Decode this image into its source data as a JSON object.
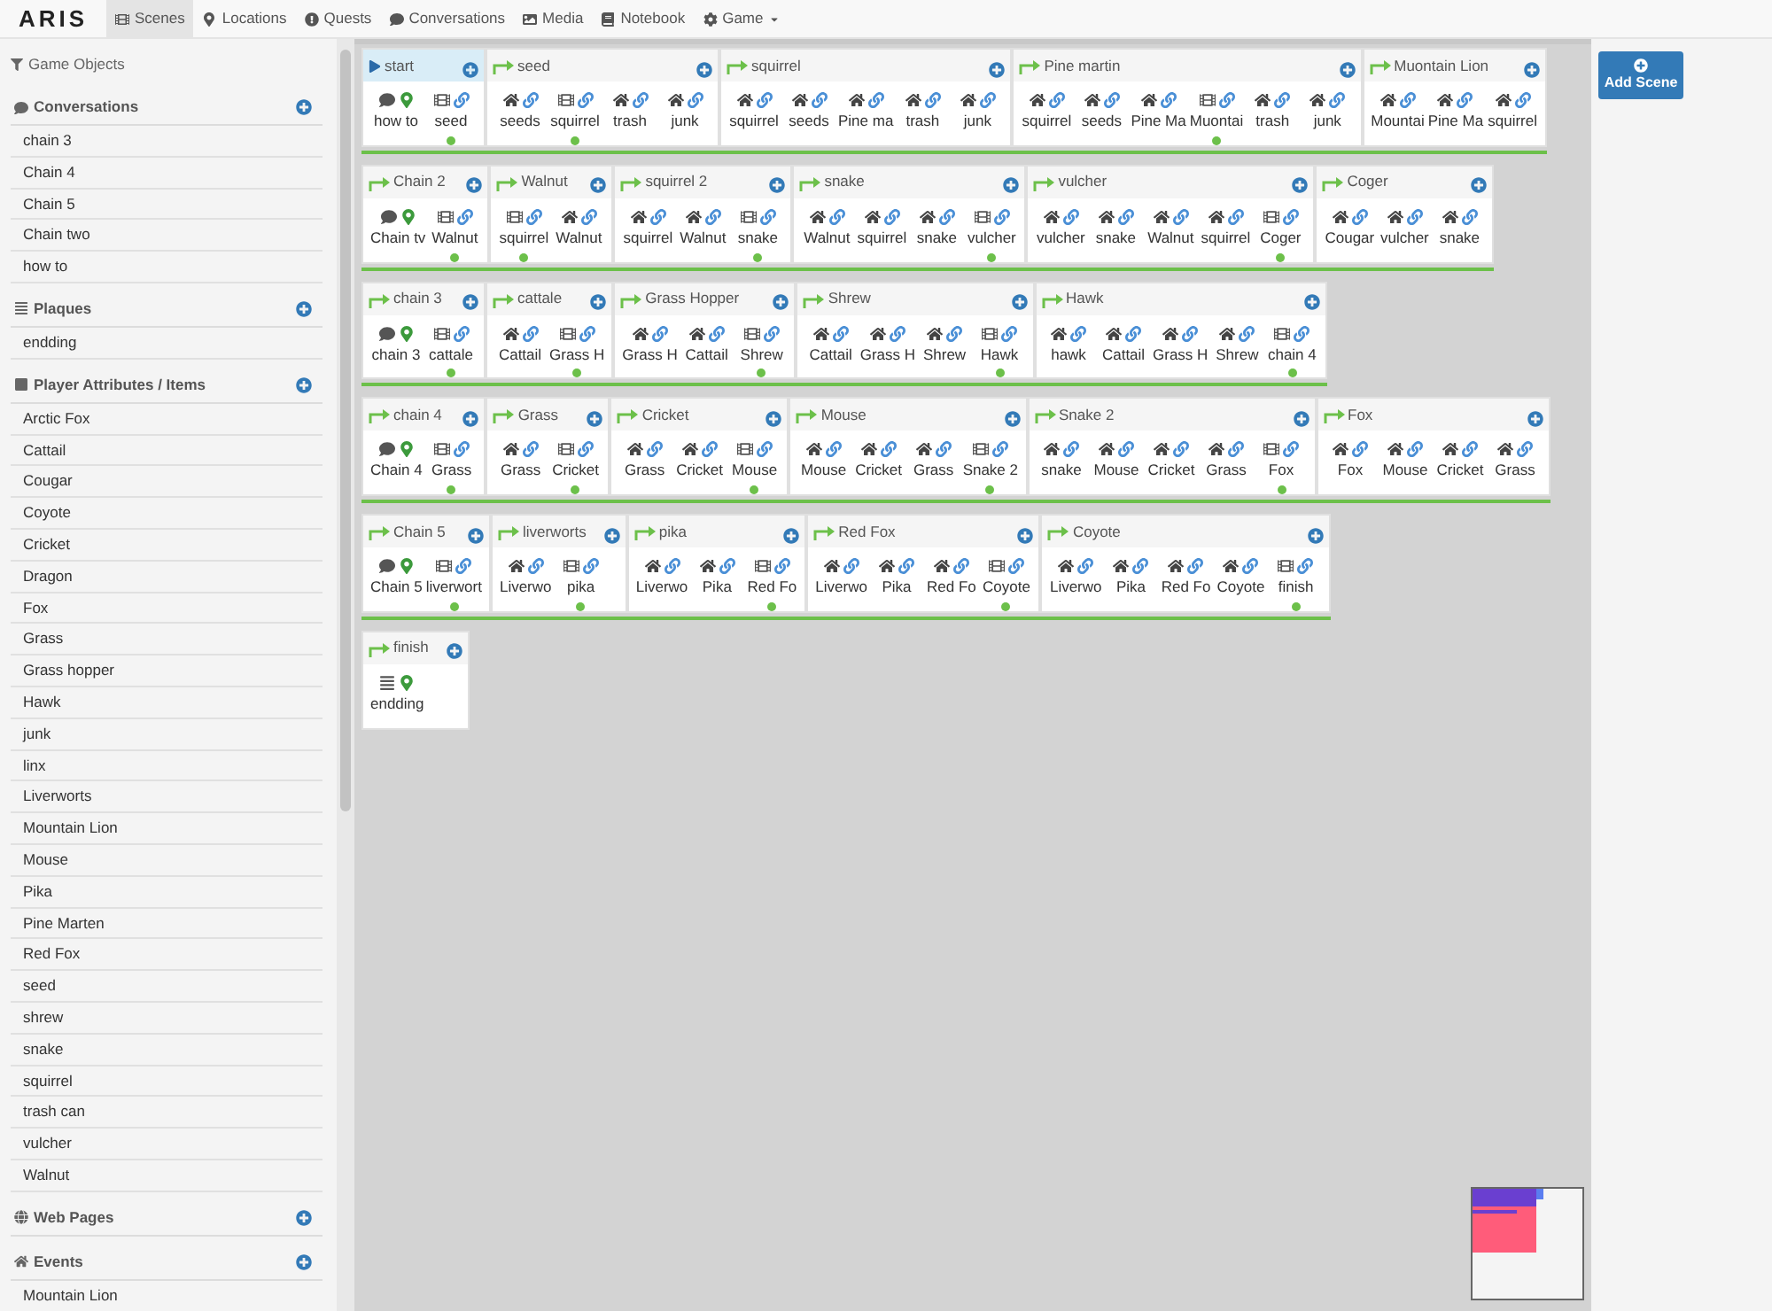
{
  "nav": {
    "logo": "ARIS",
    "tabs": [
      {
        "label": "Scenes",
        "selected": true,
        "dropdown": false
      },
      {
        "label": "Locations",
        "selected": false,
        "dropdown": false
      },
      {
        "label": "Quests",
        "selected": false,
        "dropdown": false
      },
      {
        "label": "Conversations",
        "selected": false,
        "dropdown": false
      },
      {
        "label": "Media",
        "selected": false,
        "dropdown": false
      },
      {
        "label": "Notebook",
        "selected": false,
        "dropdown": false
      },
      {
        "label": "Game",
        "selected": false,
        "dropdown": true
      }
    ]
  },
  "sidebar": {
    "title": "Game Objects",
    "sections": [
      {
        "title": "Conversations",
        "items": [
          "chain 3",
          "Chain 4",
          "Chain 5",
          "Chain two",
          "how to"
        ]
      },
      {
        "title": "Plaques",
        "items": [
          "endding"
        ]
      },
      {
        "title": "Player Attributes / Items",
        "items": [
          "Arctic Fox",
          "Cattail",
          "Cougar",
          "Coyote",
          "Cricket",
          "Dragon",
          "Fox",
          "Grass",
          "Grass hopper",
          "Hawk",
          "junk",
          "linx",
          "Liverworts",
          "Mountain Lion",
          "Mouse",
          "Pika",
          "Pine Marten",
          "Red Fox",
          "seed",
          "shrew",
          "snake",
          "squirrel",
          "trash can",
          "vulcher",
          "Walnut"
        ]
      },
      {
        "title": "Web Pages"
      },
      {
        "title": "Events",
        "items": [
          "Mountain Lion"
        ]
      }
    ]
  },
  "add_scene": {
    "label": "Add Scene"
  },
  "scene_rows": [
    [
      {
        "title": "start",
        "selected": true,
        "start": true,
        "items": [
          {
            "kind": "conversation",
            "label": "how to"
          },
          {
            "kind": "scene",
            "label": "seed"
          }
        ]
      },
      {
        "title": "seed",
        "selected": false,
        "start": false,
        "items": [
          {
            "kind": "item",
            "label": "seeds"
          },
          {
            "kind": "scene",
            "label": "squirrel"
          },
          {
            "kind": "item",
            "label": "trash"
          },
          {
            "kind": "item",
            "label": "junk"
          }
        ]
      },
      {
        "title": "squirrel",
        "selected": false,
        "start": false,
        "items": [
          {
            "kind": "item",
            "label": "squirrel"
          },
          {
            "kind": "item",
            "label": "seeds"
          },
          {
            "kind": "item",
            "label": "Pine ma"
          },
          {
            "kind": "item",
            "label": "trash"
          },
          {
            "kind": "item",
            "label": "junk"
          }
        ]
      },
      {
        "title": "Pine martin",
        "selected": false,
        "start": false,
        "items": [
          {
            "kind": "item",
            "label": "squirrel"
          },
          {
            "kind": "item",
            "label": "seeds"
          },
          {
            "kind": "item",
            "label": "Pine Ma"
          },
          {
            "kind": "scene",
            "label": "Muontai"
          },
          {
            "kind": "item",
            "label": "trash"
          },
          {
            "kind": "item",
            "label": "junk"
          }
        ]
      },
      {
        "title": "Muontain Lion",
        "selected": false,
        "start": false,
        "items": [
          {
            "kind": "item",
            "label": "Mountai"
          },
          {
            "kind": "item",
            "label": "Pine Ma"
          },
          {
            "kind": "item",
            "label": "squirrel"
          }
        ]
      }
    ],
    [
      {
        "title": "Chain 2",
        "selected": false,
        "start": false,
        "items": [
          {
            "kind": "conversation",
            "label": "Chain tv"
          },
          {
            "kind": "scene",
            "label": "Walnut"
          }
        ]
      },
      {
        "title": "Walnut",
        "selected": false,
        "start": false,
        "items": [
          {
            "kind": "scene",
            "label": "squirrel"
          },
          {
            "kind": "item",
            "label": "Walnut"
          }
        ]
      },
      {
        "title": "squirrel 2",
        "selected": false,
        "start": false,
        "items": [
          {
            "kind": "item",
            "label": "squirrel"
          },
          {
            "kind": "item",
            "label": "Walnut"
          },
          {
            "kind": "scene",
            "label": "snake"
          }
        ]
      },
      {
        "title": "snake",
        "selected": false,
        "start": false,
        "items": [
          {
            "kind": "item",
            "label": "Walnut"
          },
          {
            "kind": "item",
            "label": "squirrel"
          },
          {
            "kind": "item",
            "label": "snake"
          },
          {
            "kind": "scene",
            "label": "vulcher"
          }
        ]
      },
      {
        "title": "vulcher",
        "selected": false,
        "start": false,
        "items": [
          {
            "kind": "item",
            "label": "vulcher"
          },
          {
            "kind": "item",
            "label": "snake"
          },
          {
            "kind": "item",
            "label": "Walnut"
          },
          {
            "kind": "item",
            "label": "squirrel"
          },
          {
            "kind": "scene",
            "label": "Coger"
          }
        ]
      },
      {
        "title": "Coger",
        "selected": false,
        "start": false,
        "items": [
          {
            "kind": "item",
            "label": "Cougar"
          },
          {
            "kind": "item",
            "label": "vulcher"
          },
          {
            "kind": "item",
            "label": "snake"
          }
        ]
      }
    ],
    [
      {
        "title": "chain 3",
        "selected": false,
        "start": false,
        "items": [
          {
            "kind": "conversation",
            "label": "chain 3"
          },
          {
            "kind": "scene",
            "label": "cattale"
          }
        ]
      },
      {
        "title": "cattale",
        "selected": false,
        "start": false,
        "items": [
          {
            "kind": "item",
            "label": "Cattail"
          },
          {
            "kind": "scene",
            "label": "Grass H"
          }
        ]
      },
      {
        "title": "Grass Hopper",
        "selected": false,
        "start": false,
        "items": [
          {
            "kind": "item",
            "label": "Grass H"
          },
          {
            "kind": "item",
            "label": "Cattail"
          },
          {
            "kind": "scene",
            "label": "Shrew"
          }
        ]
      },
      {
        "title": "Shrew",
        "selected": false,
        "start": false,
        "items": [
          {
            "kind": "item",
            "label": "Cattail"
          },
          {
            "kind": "item",
            "label": "Grass H"
          },
          {
            "kind": "item",
            "label": "Shrew"
          },
          {
            "kind": "scene",
            "label": "Hawk"
          }
        ]
      },
      {
        "title": "Hawk",
        "selected": false,
        "start": false,
        "items": [
          {
            "kind": "item",
            "label": "hawk"
          },
          {
            "kind": "item",
            "label": "Cattail"
          },
          {
            "kind": "item",
            "label": "Grass H"
          },
          {
            "kind": "item",
            "label": "Shrew"
          },
          {
            "kind": "scene",
            "label": "chain 4"
          }
        ]
      }
    ],
    [
      {
        "title": "chain 4",
        "selected": false,
        "start": false,
        "items": [
          {
            "kind": "conversation",
            "label": "Chain 4"
          },
          {
            "kind": "scene",
            "label": "Grass"
          }
        ]
      },
      {
        "title": "Grass",
        "selected": false,
        "start": false,
        "items": [
          {
            "kind": "item",
            "label": "Grass"
          },
          {
            "kind": "scene",
            "label": "Cricket"
          }
        ]
      },
      {
        "title": "Cricket",
        "selected": false,
        "start": false,
        "items": [
          {
            "kind": "item",
            "label": "Grass"
          },
          {
            "kind": "item",
            "label": "Cricket"
          },
          {
            "kind": "scene",
            "label": "Mouse"
          }
        ]
      },
      {
        "title": "Mouse",
        "selected": false,
        "start": false,
        "items": [
          {
            "kind": "item",
            "label": "Mouse"
          },
          {
            "kind": "item",
            "label": "Cricket"
          },
          {
            "kind": "item",
            "label": "Grass"
          },
          {
            "kind": "scene",
            "label": "Snake 2"
          }
        ]
      },
      {
        "title": "Snake 2",
        "selected": false,
        "start": false,
        "items": [
          {
            "kind": "item",
            "label": "snake"
          },
          {
            "kind": "item",
            "label": "Mouse"
          },
          {
            "kind": "item",
            "label": "Cricket"
          },
          {
            "kind": "item",
            "label": "Grass"
          },
          {
            "kind": "scene",
            "label": "Fox"
          }
        ]
      },
      {
        "title": "Fox",
        "selected": false,
        "start": false,
        "items": [
          {
            "kind": "item",
            "label": "Fox"
          },
          {
            "kind": "item",
            "label": "Mouse"
          },
          {
            "kind": "item",
            "label": "Cricket"
          },
          {
            "kind": "item",
            "label": "Grass"
          }
        ]
      }
    ],
    [
      {
        "title": "Chain 5",
        "selected": false,
        "start": false,
        "items": [
          {
            "kind": "conversation",
            "label": "Chain 5"
          },
          {
            "kind": "scene",
            "label": "liverwort"
          }
        ]
      },
      {
        "title": "liverworts",
        "selected": false,
        "start": false,
        "items": [
          {
            "kind": "item",
            "label": "Liverwo"
          },
          {
            "kind": "scene",
            "label": "pika"
          }
        ]
      },
      {
        "title": "pika",
        "selected": false,
        "start": false,
        "items": [
          {
            "kind": "item",
            "label": "Liverwo"
          },
          {
            "kind": "item",
            "label": "Pika"
          },
          {
            "kind": "scene",
            "label": "Red Fo"
          }
        ]
      },
      {
        "title": "Red Fox",
        "selected": false,
        "start": false,
        "items": [
          {
            "kind": "item",
            "label": "Liverwo"
          },
          {
            "kind": "item",
            "label": "Pika"
          },
          {
            "kind": "item",
            "label": "Red Fo"
          },
          {
            "kind": "scene",
            "label": "Coyote"
          }
        ]
      },
      {
        "title": "Coyote",
        "selected": false,
        "start": false,
        "items": [
          {
            "kind": "item",
            "label": "Liverwo"
          },
          {
            "kind": "item",
            "label": "Pika"
          },
          {
            "kind": "item",
            "label": "Red Fo"
          },
          {
            "kind": "item",
            "label": "Coyote"
          },
          {
            "kind": "scene",
            "label": "finish"
          }
        ]
      }
    ],
    [
      {
        "title": "finish",
        "selected": false,
        "start": false,
        "items": [
          {
            "kind": "plaque",
            "label": "endding"
          }
        ]
      }
    ]
  ]
}
